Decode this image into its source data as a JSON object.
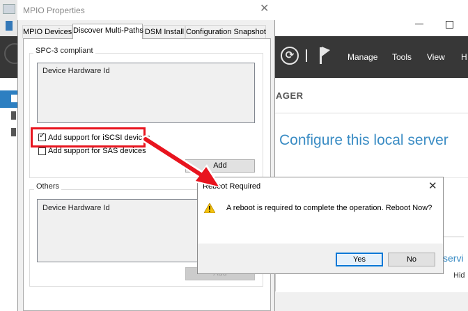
{
  "server_manager": {
    "menu": [
      "Manage",
      "Tools",
      "View",
      "H"
    ],
    "breadcrumb": "AGER",
    "configure_title": "Configure this local server",
    "e_glyph": "e",
    "serv_fragment": "servi",
    "hide_fragment": "Hid",
    "accent_color": "#3a8cc4"
  },
  "mpio_dialog": {
    "title": "MPIO Properties",
    "close_glyph": "✕",
    "tabs": [
      {
        "label": "MPIO Devices",
        "active": false
      },
      {
        "label": "Discover Multi-Paths",
        "active": true
      },
      {
        "label": "DSM Install",
        "active": false
      },
      {
        "label": "Configuration Snapshot",
        "active": false
      }
    ],
    "spc_group": {
      "label": "SPC-3 compliant",
      "list_header": "Device Hardware Id",
      "iscsi_checkbox": {
        "label": "Add support for iSCSI devices",
        "checked": true
      },
      "sas_checkbox": {
        "label": "Add support for SAS devices",
        "checked": false
      },
      "add_button": "Add"
    },
    "others_group": {
      "label": "Others",
      "list_header": "Device Hardware Id",
      "add_button": "Add"
    },
    "highlight_color": "#e8141e"
  },
  "reboot_dialog": {
    "title": "Reboot Required",
    "close_glyph": "✕",
    "message": "A reboot is required to complete the operation. Reboot Now?",
    "yes_button": "Yes",
    "no_button": "No",
    "icon": "warning-icon"
  }
}
